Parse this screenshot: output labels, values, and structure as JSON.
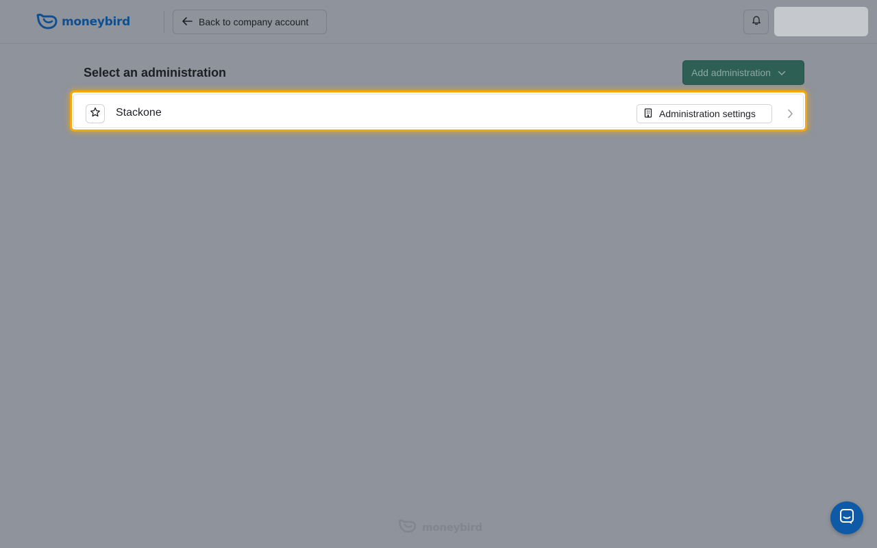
{
  "header": {
    "logo_text": "moneybird",
    "back_label": "Back to company account"
  },
  "main": {
    "title": "Select an administration",
    "add_button_label": "Add administration",
    "administrations": [
      {
        "name": "Stackone",
        "settings_label": "Administration settings"
      }
    ]
  },
  "footer": {
    "logo_text": "moneybird"
  },
  "colors": {
    "brand_blue": "#0f4f8f",
    "primary_green": "#2e5f55",
    "highlight": "#f5a70f",
    "chat_blue": "#0f5aa6"
  }
}
